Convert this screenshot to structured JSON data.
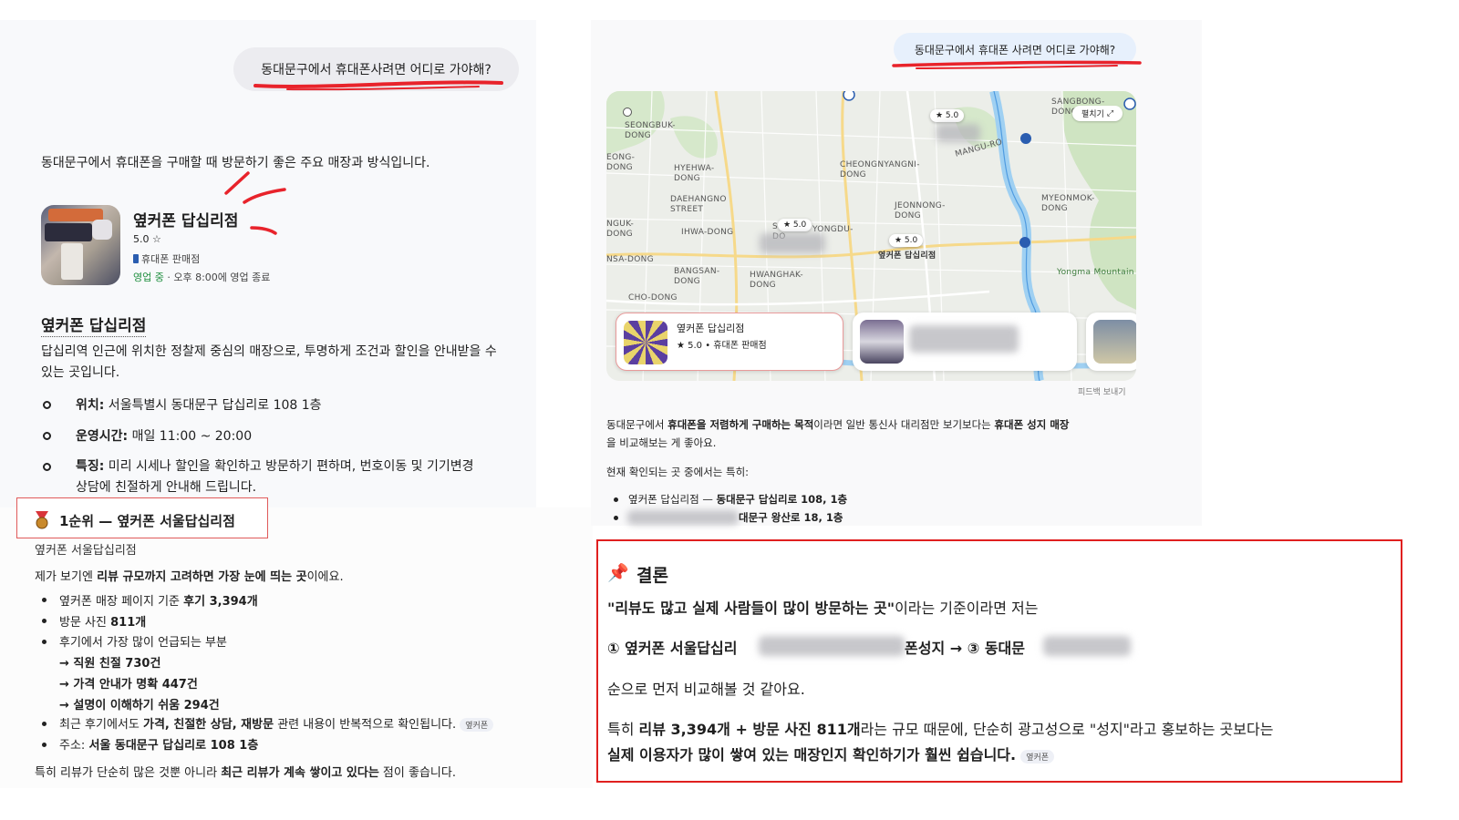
{
  "left": {
    "user_query": "동대문구에서 휴대폰사려면 어디로 가야해?",
    "intro": "동대문구에서 휴대폰을 구매할 때 방문하기 좋은 주요 매장과 방식입니다.",
    "store": {
      "name": "옆커폰 답십리점",
      "rating": "5.0 ☆",
      "category": "휴대폰 판매점",
      "open_status": "영업 중",
      "hours_note": " · 오후 8:00에 영업 종료"
    },
    "section_title": "옆커폰 답십리점",
    "desc_line1": "답십리역 인근에 위치한 정찰제 중심의 매장으로, 투명하게 조건과 할인을 안내받을 수",
    "desc_line2": "있는 곳입니다.",
    "info": [
      {
        "label": "위치:",
        "value": " 서울특별시 동대문구 답십리로 108 1층"
      },
      {
        "label": "운영시간:",
        "value": " 매일 11:00 ~ 20:00"
      },
      {
        "label": "특징:",
        "value": " 미리 시세나 할인을 확인하고 방문하기 편하며, 번호이동 및 기기변경"
      }
    ],
    "info_cont": "상담에 친절하게 안내해 드립니다.",
    "rank_title": "1순위 — 옆커폰 서울답십리점",
    "rank_sub": "옆커폰 서울답십리점",
    "rank_intro_pre": "제가 보기엔 ",
    "rank_intro_bold": "리뷰 규모까지 고려하면 가장 눈에 띄는 곳",
    "rank_intro_post": "이에요.",
    "bullets": {
      "b1_pre": "옆커폰 매장 페이지 기준 ",
      "b1_bold": "후기 3,394개",
      "b2_pre": "방문 사진 ",
      "b2_bold": "811개",
      "b3": "후기에서 가장 많이 언급되는 부분",
      "sub1": "→ 직원 친절 730건",
      "sub2": "→ 가격 안내가 명확 447건",
      "sub3": "→ 설명이 이해하기 쉬움 294건",
      "b4_pre": "최근 후기에서도 ",
      "b4_bold": "가격, 친절한 상담, 재방문",
      "b4_post": " 관련 내용이 반복적으로 확인됩니다.",
      "chip": "옆커폰",
      "b5_pre": "주소: ",
      "b5_bold": "서울 동대문구 답십리로 108 1층"
    },
    "footer_pre": "특히 리뷰가 단순히 많은 것뿐 아니라 ",
    "footer_bold": "최근 리뷰가 계속 쌓이고 있다는",
    "footer_post": " 점이 좋습니다."
  },
  "right": {
    "user_query": "동대문구에서 휴대폰 사려면 어디로 가야해?",
    "map": {
      "expand_label": "펼치기",
      "labels": [
        "SEONGBUK-\nDONG",
        "HYEHWA-\nDONG",
        "DAEHANGNO\nSTREET",
        "IHWA-DONG",
        "CHEONGNYANGNI-\nDONG",
        "JEONNONG-\nDONG",
        "MYEONMOK-\nDONG",
        "SANGBONG-\nDONG",
        "MANGU-RO",
        "SUNGIN\nDO",
        "YONGDU-",
        "BANGSAN-\nDONG",
        "HWANGHAK-\nDONG",
        "CHO-DONG",
        "NSA-DONG",
        "EONG-\nDONG",
        "NGUK-\nDONG",
        "Yongma Mountain"
      ],
      "pins": [
        "★ 5.0",
        "★ 5.0",
        "★ 5.0"
      ],
      "store_pin_label": "옆커폰 답십리점",
      "card_name": "옆커폰 답십리점",
      "card_meta": "★ 5.0 • 휴대폰 판매점",
      "feedback": "피드백 보내기"
    },
    "para1_a": "동대문구에서 ",
    "para1_b": "휴대폰을 저렴하게 구매하는 목적",
    "para1_c": "이라면 일반 통신사 대리점만 보기보다는 ",
    "para1_d": "휴대폰 성지 매장",
    "para1_line2": "을 비교해보는 게 좋아요.",
    "para2": "현재 확인되는 곳 중에서는 특히:",
    "list1": "옆커폰 답십리점 — ",
    "list1_bold": "동대문구 답십리로 108, 1층",
    "list2_bold": "대문구 왕산로 18, 1층"
  },
  "conclusion": {
    "icon": "📌",
    "title": "결론",
    "line1_bold": "\"리뷰도 많고 실제 사람들이 많이 방문하는 곳\"",
    "line1_post": "이라는 기준이라면 저는",
    "line2_a": "① 옆커폰 서울답십리",
    "line2_b": "폰성지 → ③ 동대문",
    "line3": "순으로 먼저 비교해볼 것 같아요.",
    "line4_a": "특히 ",
    "line4_b": "리뷰 3,394개 + 방문 사진 811개",
    "line4_c": "라는 규모 때문에, 단순히 광고성으로 \"성지\"라고 홍보하는 곳보다는",
    "line5_bold": "실제 이용자가 많이 쌓여 있는 매장인지 확인하기가 훨씬 쉽습니다.",
    "chip": "옆커폰"
  }
}
